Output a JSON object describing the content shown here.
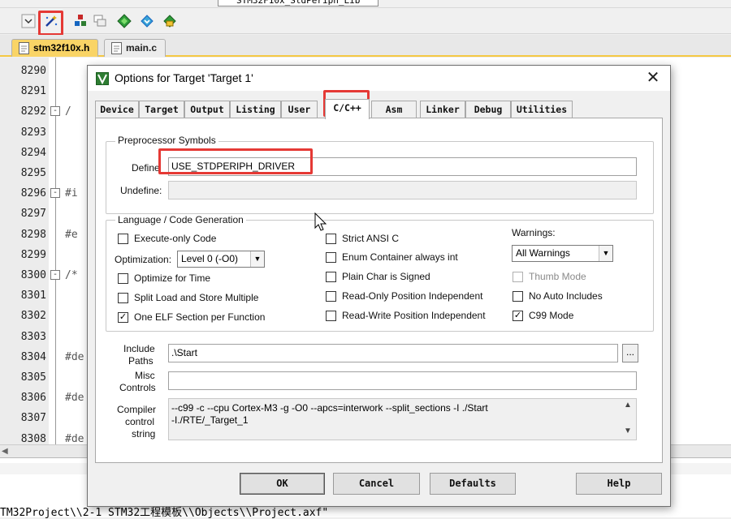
{
  "toolbar": {
    "target_combo_value": "STM32F10x_StdPeriph_Lib",
    "buttons": [
      "options-for-target",
      "component-manager",
      "file-extensions",
      "pack-installer",
      "select-packs",
      "manage-rte"
    ]
  },
  "file_tabs": [
    {
      "label": "stm32f10x.h",
      "active": true
    },
    {
      "label": "main.c",
      "active": false
    }
  ],
  "editor": {
    "lines": [
      {
        "num": "8290",
        "code": ""
      },
      {
        "num": "8291",
        "code": ""
      },
      {
        "num": "8292",
        "code": "/",
        "fold": "-"
      },
      {
        "num": "8293",
        "code": ""
      },
      {
        "num": "8294",
        "code": ""
      },
      {
        "num": "8295",
        "code": ""
      },
      {
        "num": "8296",
        "code": "#i",
        "fold": "-"
      },
      {
        "num": "8297",
        "code": ""
      },
      {
        "num": "8298",
        "code": "#e"
      },
      {
        "num": "8299",
        "code": ""
      },
      {
        "num": "8300",
        "code": "/*",
        "fold": "-"
      },
      {
        "num": "8301",
        "code": ""
      },
      {
        "num": "8302",
        "code": ""
      },
      {
        "num": "8303",
        "code": ""
      },
      {
        "num": "8304",
        "code": "#de"
      },
      {
        "num": "8305",
        "code": ""
      },
      {
        "num": "8306",
        "code": "#de"
      },
      {
        "num": "8307",
        "code": ""
      },
      {
        "num": "8308",
        "code": "#de"
      }
    ]
  },
  "build_output": {
    "line": "TM32Project\\\\2-1 STM32工程模板\\\\Objects\\\\Project.axf\""
  },
  "dialog": {
    "title": "Options for Target 'Target 1'",
    "tabs": [
      "Device",
      "Target",
      "Output",
      "Listing",
      "User",
      "C/C++",
      "Asm",
      "Linker",
      "Debug",
      "Utilities"
    ],
    "active_tab": "C/C++",
    "preprocessor": {
      "group_label": "Preprocessor Symbols",
      "define_label": "Define",
      "define_value": "USE_STDPERIPH_DRIVER",
      "undefine_label": "Undefine:",
      "undefine_value": ""
    },
    "language": {
      "group_label": "Language / Code Generation",
      "execute_only": {
        "label": "Execute-only Code",
        "checked": false
      },
      "optimization_label": "Optimization:",
      "optimization_value": "Level 0 (-O0)",
      "optimize_time": {
        "label": "Optimize for Time",
        "checked": false
      },
      "split_load": {
        "label": "Split Load and Store Multiple",
        "checked": false
      },
      "one_elf": {
        "label": "One ELF Section per Function",
        "checked": true
      },
      "strict_ansi": {
        "label": "Strict ANSI C",
        "checked": false
      },
      "enum_container": {
        "label": "Enum Container always int",
        "checked": false
      },
      "plain_char": {
        "label": "Plain Char is Signed",
        "checked": false
      },
      "ro_position": {
        "label": "Read-Only Position Independent",
        "checked": false
      },
      "rw_position": {
        "label": "Read-Write Position Independent",
        "checked": false
      },
      "warnings_label": "Warnings:",
      "warnings_value": "All Warnings",
      "thumb_mode": {
        "label": "Thumb Mode",
        "checked": false,
        "disabled": true
      },
      "no_auto_includes": {
        "label": "No Auto Includes",
        "checked": false
      },
      "c99_mode": {
        "label": "C99 Mode",
        "checked": true
      }
    },
    "include_paths": {
      "label_line1": "Include",
      "label_line2": "Paths",
      "value": ".\\Start",
      "browse": "..."
    },
    "misc_controls": {
      "label_line1": "Misc",
      "label_line2": "Controls",
      "value": ""
    },
    "compiler_string": {
      "label_line1": "Compiler",
      "label_line2": "control",
      "label_line3": "string",
      "value": "--c99 -c --cpu Cortex-M3 -g -O0 --apcs=interwork --split_sections -I ./Start\n-I./RTE/_Target_1"
    },
    "buttons": {
      "ok": "OK",
      "cancel": "Cancel",
      "defaults": "Defaults",
      "help": "Help"
    },
    "check_mark": "✓"
  },
  "colors": {
    "highlight": "#e53935",
    "active_file_tab": "#f9d466"
  }
}
